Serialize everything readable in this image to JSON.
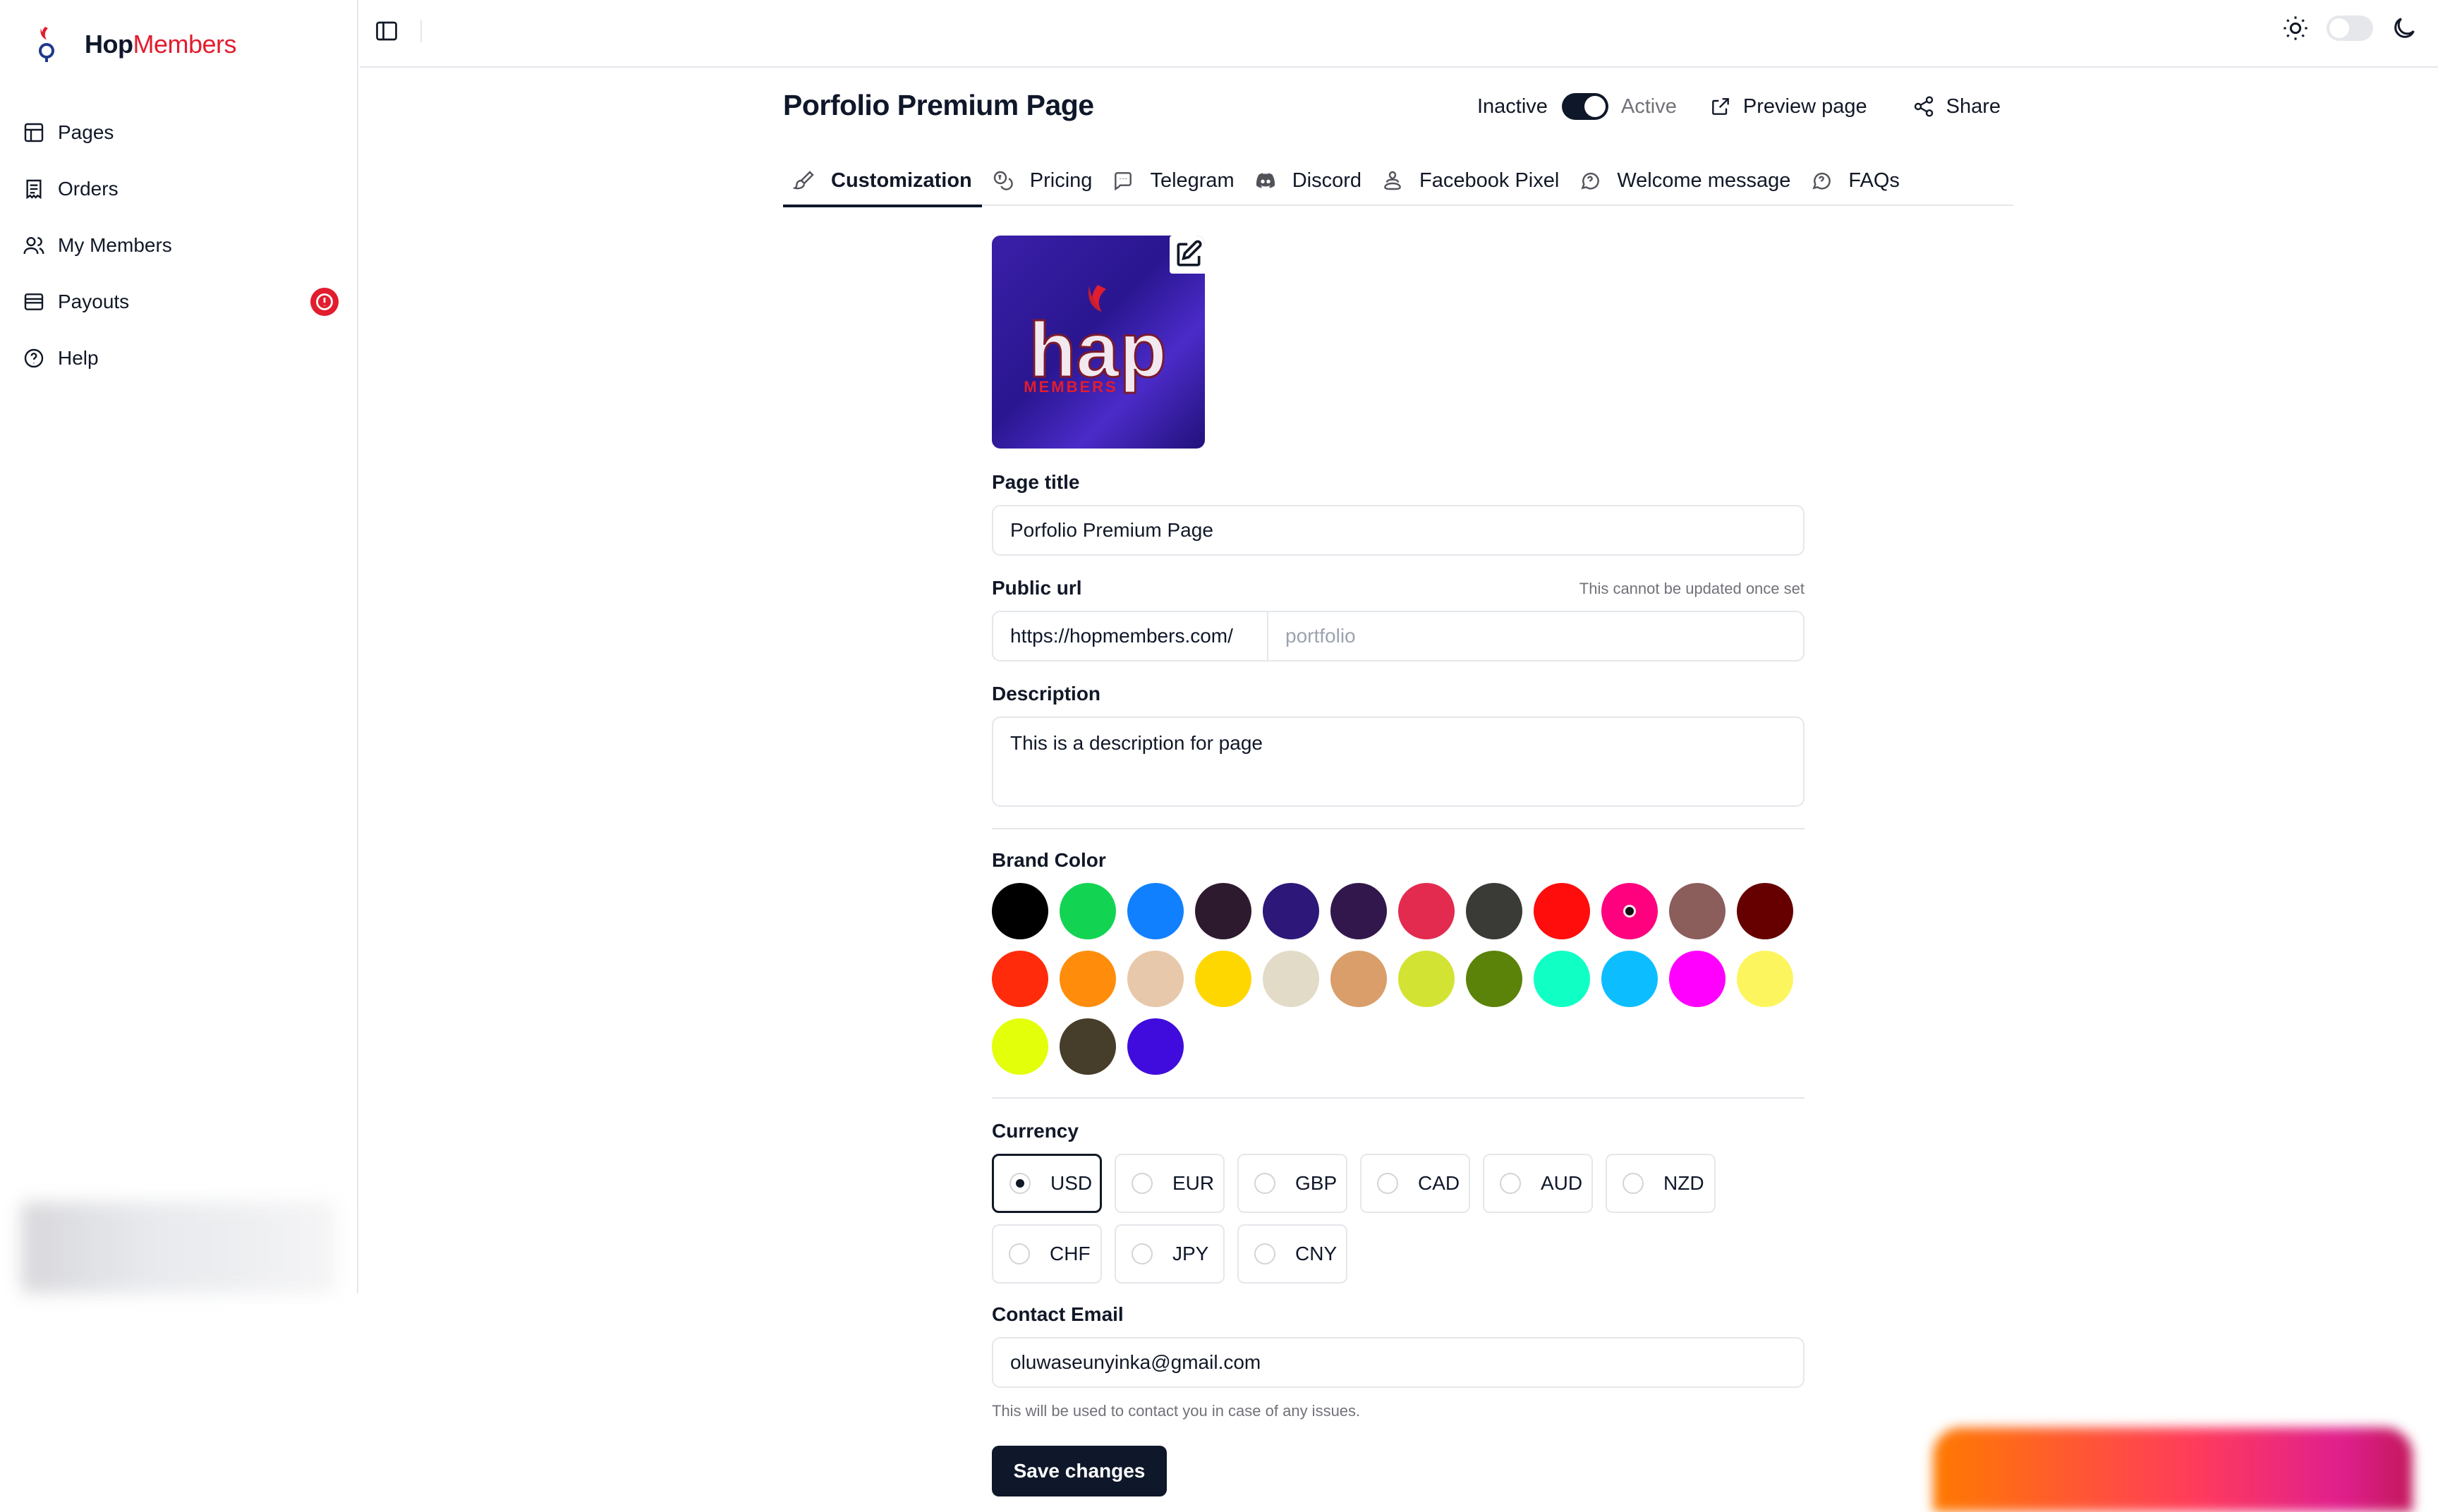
{
  "app": {
    "brand_primary": "Hop",
    "brand_accent": "Members",
    "accent_color": "#e11d2e"
  },
  "sidebar": {
    "items": [
      {
        "label": "Pages",
        "icon": "layout-icon"
      },
      {
        "label": "Orders",
        "icon": "receipt-icon"
      },
      {
        "label": "My Members",
        "icon": "users-icon"
      },
      {
        "label": "Payouts",
        "icon": "wallet-icon",
        "badge": "!"
      },
      {
        "label": "Help",
        "icon": "help-circle-icon"
      }
    ]
  },
  "header": {
    "title": "Porfolio Premium Page",
    "status_inactive": "Inactive",
    "status_active": "Active",
    "preview_label": "Preview page",
    "share_label": "Share"
  },
  "tabs": [
    {
      "label": "Customization",
      "icon": "brush-icon",
      "active": true
    },
    {
      "label": "Pricing",
      "icon": "coins-icon"
    },
    {
      "label": "Telegram",
      "icon": "telegram-icon"
    },
    {
      "label": "Discord",
      "icon": "discord-icon"
    },
    {
      "label": "Facebook Pixel",
      "icon": "pixel-icon"
    },
    {
      "label": "Welcome message",
      "icon": "message-icon"
    },
    {
      "label": "FAQs",
      "icon": "faq-icon"
    }
  ],
  "form": {
    "page_title_label": "Page title",
    "page_title_value": "Porfolio Premium Page",
    "public_url_label": "Public url",
    "public_url_hint": "This cannot be updated once set",
    "public_url_prefix": "https://hopmembers.com/",
    "public_url_placeholder": "portfolio",
    "description_label": "Description",
    "description_value": "This is a description for page",
    "brand_color_label": "Brand Color",
    "brand_colors": [
      "#000000",
      "#13d452",
      "#1180ff",
      "#2e1a2e",
      "#2d1779",
      "#32174d",
      "#e32b4f",
      "#3a3a36",
      "#ff0c0c",
      "#ff007f",
      "#8b5d5b",
      "#660000",
      "#ff2b0a",
      "#ff8c0a",
      "#e8c8aa",
      "#ffd700",
      "#e2dbc8",
      "#d99e6a",
      "#d3e333",
      "#5b8209",
      "#10ffc5",
      "#0cbeff",
      "#ff00fe",
      "#fdf55e",
      "#e3ff0a",
      "#463d2a",
      "#3f0cdd"
    ],
    "selected_brand_color": "#ff007f",
    "currency_label": "Currency",
    "currencies": [
      "USD",
      "EUR",
      "GBP",
      "CAD",
      "AUD",
      "NZD",
      "CHF",
      "JPY",
      "CNY"
    ],
    "selected_currency": "USD",
    "contact_email_label": "Contact Email",
    "contact_email_value": "oluwaseunyinka@gmail.com",
    "contact_email_hint": "This will be used to contact you in case of any issues.",
    "save_label": "Save changes"
  }
}
